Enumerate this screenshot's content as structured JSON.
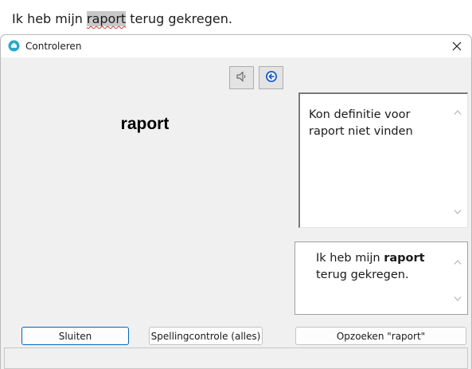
{
  "document": {
    "prefix": "Ik heb mijn ",
    "highlighted": "raport",
    "suffix": " terug gekregen."
  },
  "dialog": {
    "title": "Controleren",
    "word": "raport",
    "definition": "Kon definitie voor raport niet vinden",
    "context_prefix": "Ik heb mijn ",
    "context_word": "raport",
    "context_suffix": " terug gekregen."
  },
  "buttons": {
    "close": "Sluiten",
    "spellcheck_all": "Spellingcontrole (alles)",
    "lookup": "Opzoeken \"raport\""
  },
  "icons": {
    "speaker": "speaker-icon",
    "back": "back-arrow-icon",
    "close": "close-icon",
    "app": "app-icon"
  },
  "colors": {
    "accent": "#0067c0",
    "highlight": "#c8c8c8",
    "spell_underline": "#d23a3a"
  }
}
